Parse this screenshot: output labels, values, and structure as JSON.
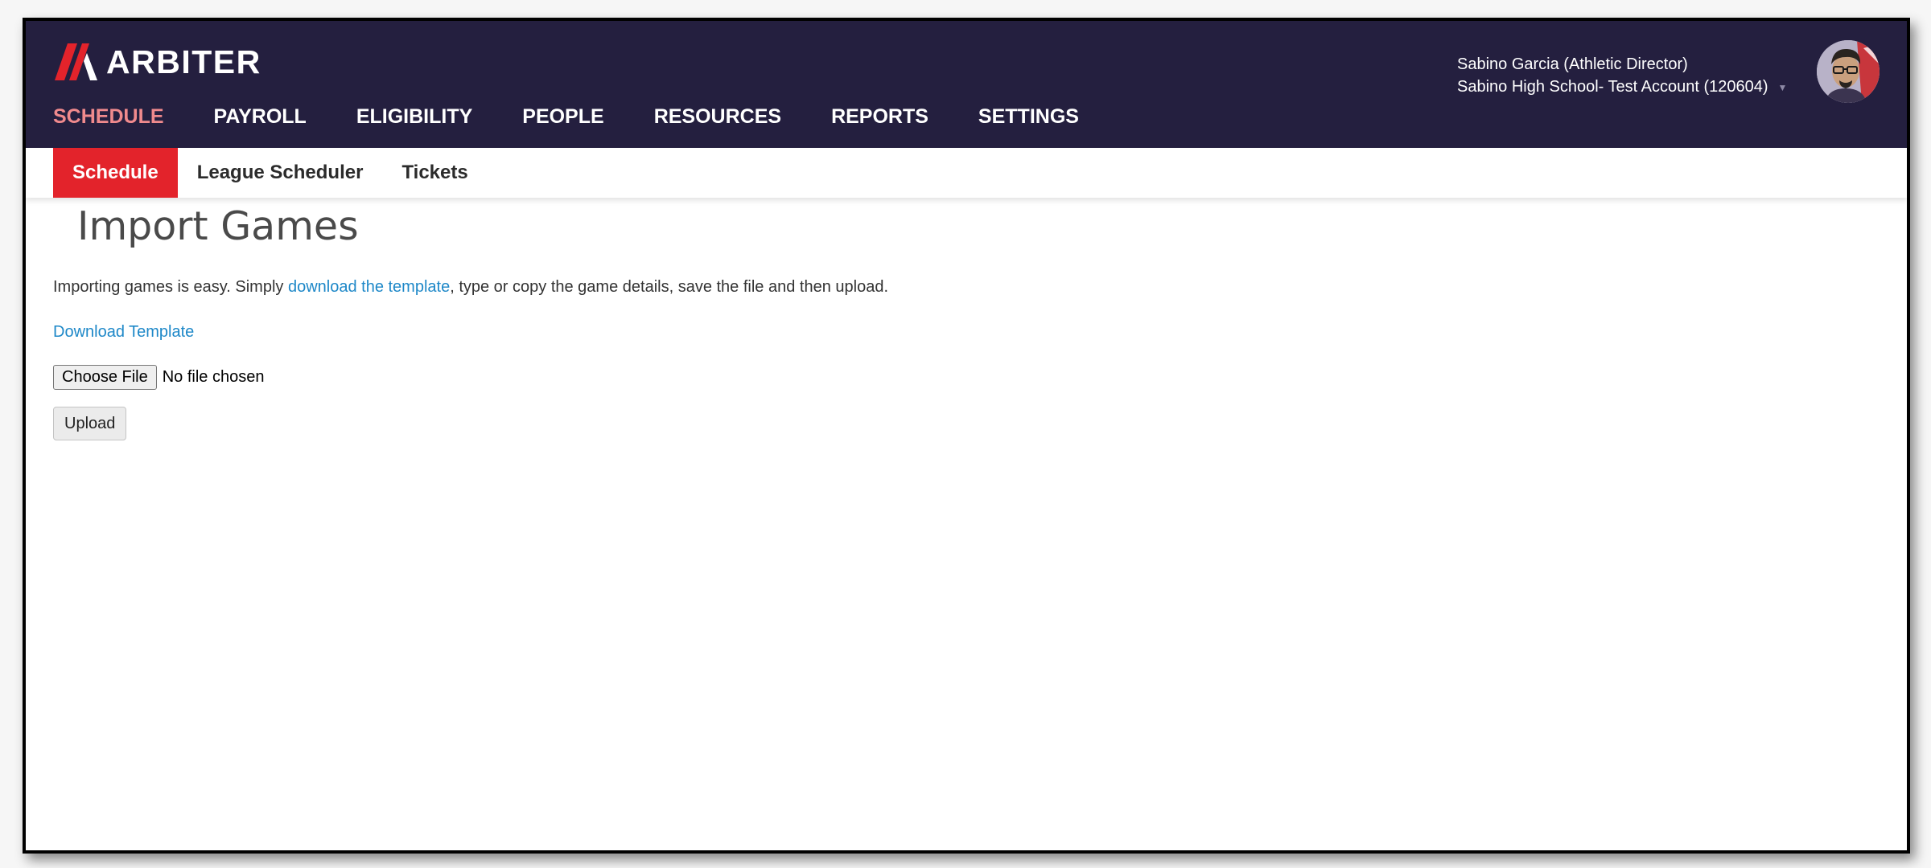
{
  "header": {
    "brand": "ARBITER",
    "colors": {
      "header_bg": "#241f3f",
      "accent": "#e3232b",
      "active_nav": "#f08a8d",
      "link": "#1e88c8"
    },
    "nav": [
      {
        "label": "SCHEDULE",
        "active": true
      },
      {
        "label": "PAYROLL"
      },
      {
        "label": "ELIGIBILITY"
      },
      {
        "label": "PEOPLE"
      },
      {
        "label": "RESOURCES"
      },
      {
        "label": "REPORTS"
      },
      {
        "label": "SETTINGS"
      }
    ],
    "user": {
      "name": "Sabino Garcia (Athletic Director)",
      "account": "Sabino High School- Test Account (120604)",
      "caret_icon": "chevron-down-icon",
      "avatar_icon": "user-avatar"
    }
  },
  "subnav": {
    "tabs": [
      {
        "label": "Schedule",
        "active": true
      },
      {
        "label": "League Scheduler"
      },
      {
        "label": "Tickets"
      }
    ]
  },
  "main": {
    "title": "Import Games",
    "intro_before": "Importing games is easy. Simply ",
    "intro_link": "download the template",
    "intro_after": ", type or copy the game details, save the file and then upload.",
    "download_link": "Download Template",
    "file_input": {
      "button_label": "Choose File",
      "status": "No file chosen"
    },
    "upload_label": "Upload"
  }
}
